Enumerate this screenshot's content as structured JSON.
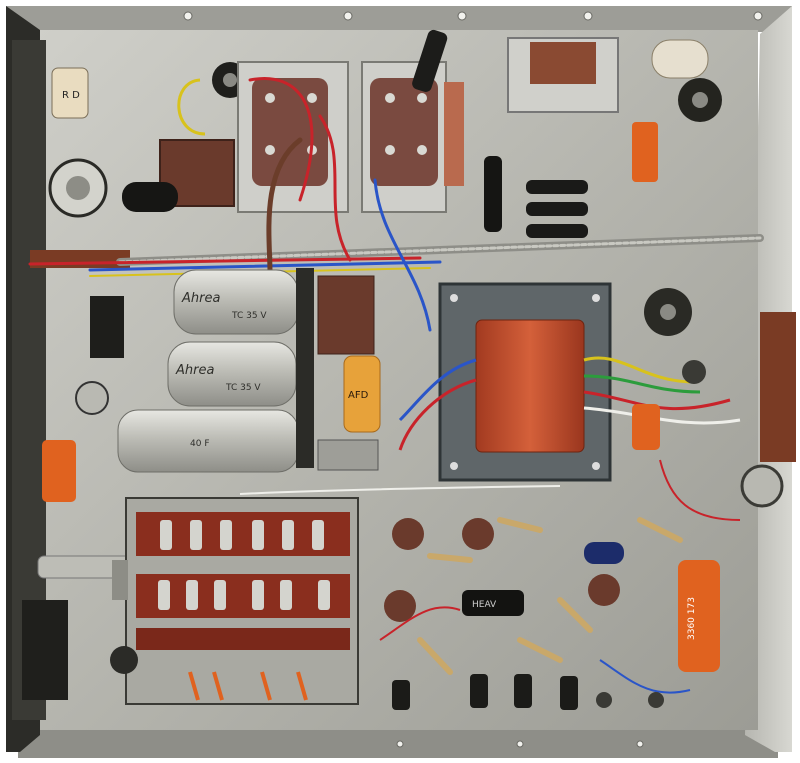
{
  "photo": {
    "subject": "underside of vintage valve amplifier chassis",
    "colors": {
      "chassis": "#b9b9b3",
      "chassis_shadow": "#6f6f69",
      "chassis_edge": "#8c8c86",
      "frame_dark": "#2a2a26",
      "transformer_orange": "#c9532f",
      "transformer_iron": "#6d7478",
      "bakelite": "#6a3a2c",
      "switch_board": "#8a2e1e",
      "cap_silver": "#c7c7c2",
      "wire_red": "#c8232a",
      "wire_blue": "#2a55c8",
      "wire_yellow": "#d8c21c",
      "wire_white": "#efefea",
      "wire_green": "#2c9c3c",
      "cap_orange": "#e0621f"
    }
  },
  "labels": {
    "can_cap_top_brand": "Ahrea",
    "can_cap_top_rating": "TC 35 V",
    "can_cap_mid_brand": "Ahrea",
    "can_cap_mid_rating": "TC 35 V",
    "can_cap_bottom_rating": "40 F",
    "resistor_top_left": "R D",
    "small_cap_center": "AFD",
    "red_cap_right": "3360 173",
    "black_cap_bottom": "HEAV"
  }
}
